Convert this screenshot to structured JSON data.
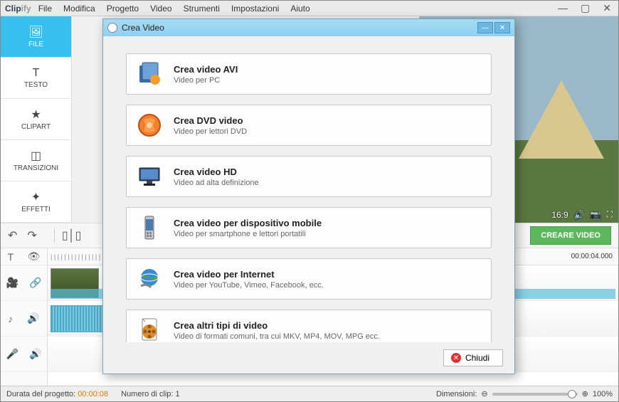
{
  "app": {
    "name_prefix": "Clip",
    "name_suffix": "ify"
  },
  "menus": [
    "File",
    "Modifica",
    "Progetto",
    "Video",
    "Strumenti",
    "Impostazioni",
    "Aiuto"
  ],
  "sidebar": {
    "items": [
      {
        "label": "FILE",
        "icon": "🖼"
      },
      {
        "label": "TESTO",
        "icon": "T"
      },
      {
        "label": "CLIPART",
        "icon": "★"
      },
      {
        "label": "TRANSIZIONI",
        "icon": "◫"
      },
      {
        "label": "EFFETTI",
        "icon": "✦"
      }
    ]
  },
  "preview": {
    "ratio": "16:9"
  },
  "toolbar": {
    "create_label": "CREARE VIDEO"
  },
  "timeline": {
    "right_time": "00:00:04.000"
  },
  "statusbar": {
    "duration_label": "Durata del progetto:",
    "duration_value": "00:00:08",
    "clips_label": "Numero di clip:",
    "clips_value": "1",
    "dim_label": "Dimensioni:",
    "zoom_value": "100%"
  },
  "dialog": {
    "title": "Crea Video",
    "options": [
      {
        "title": "Crea video AVI",
        "subtitle": "Video per PC",
        "icon": "avi"
      },
      {
        "title": "Crea DVD video",
        "subtitle": "Video per lettori DVD",
        "icon": "dvd"
      },
      {
        "title": "Crea video HD",
        "subtitle": "Video ad alta definizione",
        "icon": "hd"
      },
      {
        "title": "Crea video per dispositivo mobile",
        "subtitle": "Video per smartphone e lettori portatili",
        "icon": "mobile"
      },
      {
        "title": "Crea video per Internet",
        "subtitle": "Video per YouTube, Vimeo, Facebook, ecc.",
        "icon": "web"
      },
      {
        "title": "Crea altri tipi di video",
        "subtitle": "Video di formati comuni, tra cui MKV, MP4, MOV, MPG ecc.",
        "icon": "other"
      }
    ],
    "close_label": "Chiudi"
  }
}
